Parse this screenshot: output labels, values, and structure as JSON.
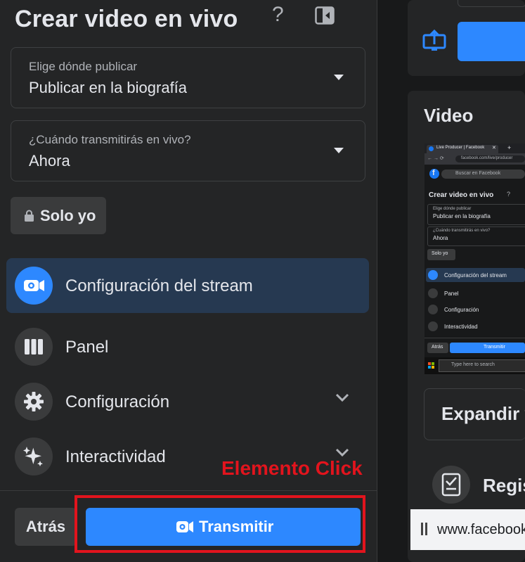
{
  "left_panel": {
    "title": "Crear video en vivo",
    "publish_dropdown": {
      "label": "Elige dónde publicar",
      "value": "Publicar en la biografía"
    },
    "when_dropdown": {
      "label": "¿Cuándo transmitirás en vivo?",
      "value": "Ahora"
    },
    "privacy_button": {
      "label": "Solo yo",
      "icon": "lock-icon"
    },
    "menu": [
      {
        "label": "Configuración del stream",
        "icon": "video-camera-icon",
        "active": true
      },
      {
        "label": "Panel",
        "icon": "panel-columns-icon",
        "active": false
      },
      {
        "label": "Configuración",
        "icon": "gear-icon",
        "active": false
      },
      {
        "label": "Interactividad",
        "icon": "sparkles-icon",
        "active": false
      }
    ],
    "footer": {
      "back_label": "Atrás",
      "stream_label": "Transmitir"
    }
  },
  "annotation": {
    "label": "Elemento Click",
    "color": "#e2141d"
  },
  "right_panel": {
    "video_title": "Video",
    "expand_label": "Expandir v",
    "register_label": "Regis",
    "status_url": "www.facebook.c",
    "thumbnail": {
      "tab_title": "Live Producer | Facebook",
      "url": "facebook.com/live/producer",
      "search_placeholder": "Buscar en Facebook",
      "title": "Crear video en vivo",
      "publish_label": "Elige dónde publicar",
      "publish_value": "Publicar en la biografía",
      "when_label": "¿Cuándo transmitirás en vivo?",
      "when_value": "Ahora",
      "privacy": "Solo yo",
      "menu": [
        "Configuración del stream",
        "Panel",
        "Configuración",
        "Interactividad"
      ],
      "back": "Atrás",
      "stream": "Transmitir",
      "taskbar_search": "Type here to search"
    }
  },
  "colors": {
    "accent": "#2d88ff",
    "panel": "#242526",
    "background": "#18191a"
  }
}
